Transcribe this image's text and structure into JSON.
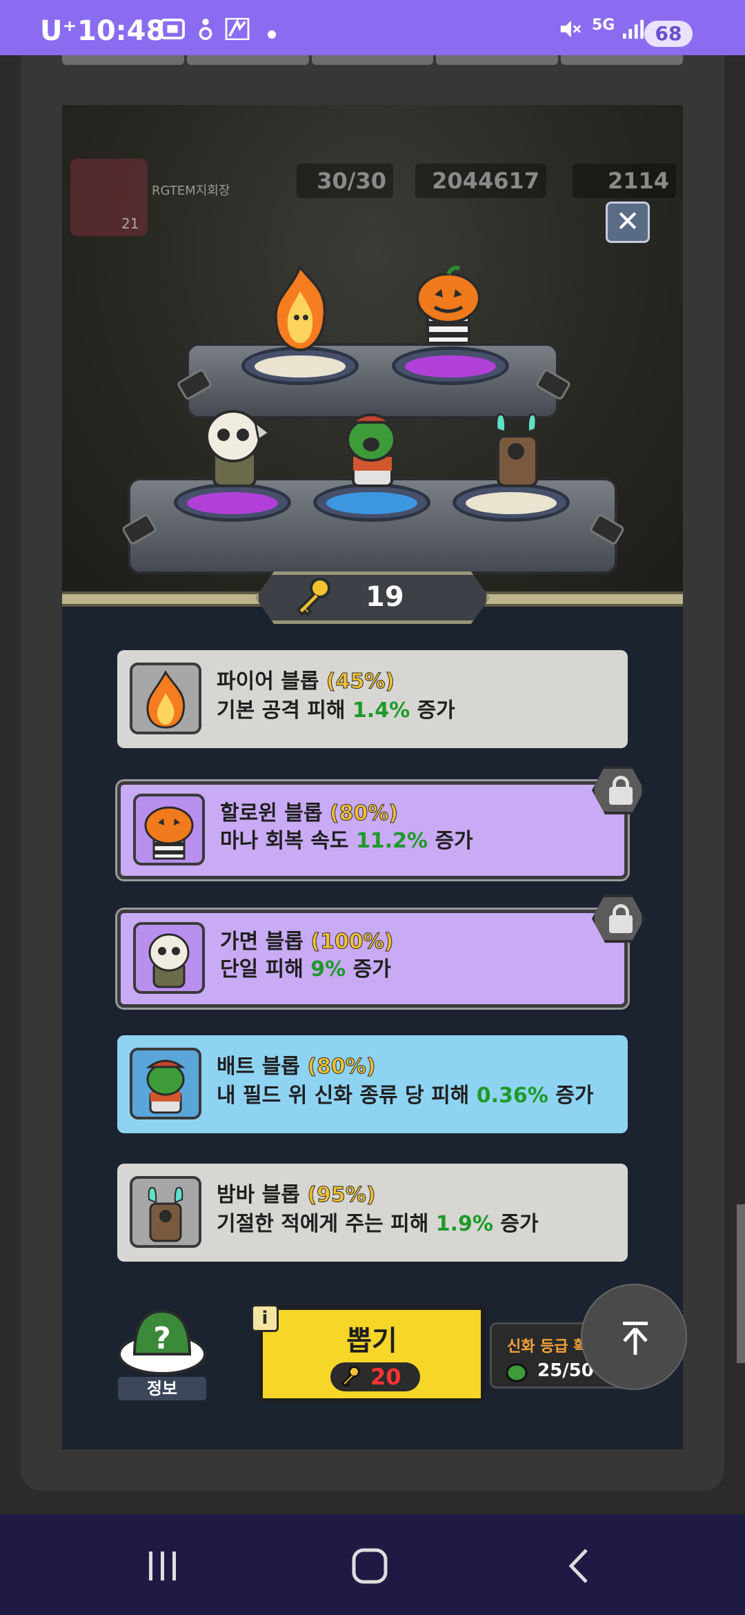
{
  "status_bar": {
    "carrier": "U⁺",
    "time": "10:48",
    "battery": "68",
    "network": "5G"
  },
  "hud": {
    "player_name": "RGTEM지회장",
    "player_level": "21",
    "energy": "30/30",
    "coins": "2044617",
    "gems": "2114"
  },
  "keys": {
    "count": "19"
  },
  "cards": [
    {
      "name": "파이어 블롭",
      "pct": "(45%)",
      "desc_before": "기본 공격 피해 ",
      "value": "1.4%",
      "desc_after": " 증가",
      "style": "gray",
      "locked": false
    },
    {
      "name": "할로윈 블롭",
      "pct": "(80%)",
      "desc_before": "마나 회복 속도 ",
      "value": "11.2%",
      "desc_after": " 증가",
      "style": "purple",
      "locked": true
    },
    {
      "name": "가면 블롭",
      "pct": "(100%)",
      "desc_before": "단일 피해 ",
      "value": "9%",
      "desc_after": " 증가",
      "style": "purple",
      "locked": true
    },
    {
      "name": "배트 블롭",
      "pct": "(80%)",
      "desc_before": "내 필드 위 신화 종류 당 피해 ",
      "value": "0.36%",
      "desc_after": " 증가",
      "style": "blue",
      "locked": false
    },
    {
      "name": "밤바 블롭",
      "pct": "(95%)",
      "desc_before": "기절한 적에게 주는 피해 ",
      "value": "1.9%",
      "desc_after": " 증가",
      "style": "gray",
      "locked": false
    }
  ],
  "bottom": {
    "info_label": "정보",
    "info_badge": "i",
    "draw_label": "뽑기",
    "draw_cost": "20",
    "mythic_title": "신화 등급 확",
    "mythic_count": "25/50"
  },
  "colors": {
    "status_bar": "#8b6cf0",
    "pct_yellow": "#f2c230",
    "value_green": "#1d9a2a",
    "draw_button": "#f5d629",
    "cost_red": "#ff3434"
  }
}
